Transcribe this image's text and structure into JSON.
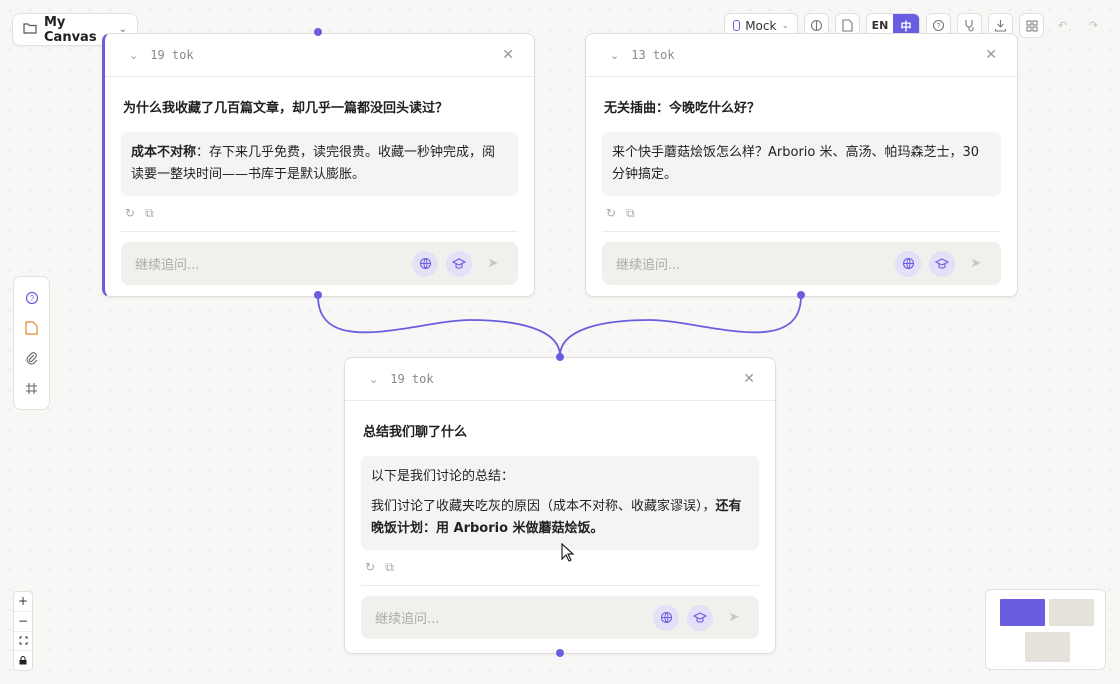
{
  "canvas_selector": {
    "label": "My Canvas",
    "icon": "folder-icon"
  },
  "toolbar": {
    "model_label": "Mock",
    "lang_en": "EN",
    "lang_zh": "中",
    "accent": "#6a5ee0"
  },
  "cards": [
    {
      "tokens": "19 tok",
      "question": "为什么我收藏了几百篇文章，却几乎一篇都没回头读过？",
      "answer_bold": "成本不对称",
      "answer_rest": "：存下来几乎免费，读完很贵。收藏一秒钟完成，阅读要一整块时间——书库于是默认膨胀。",
      "followup_placeholder": "继续追问..."
    },
    {
      "tokens": "13 tok",
      "question": "无关插曲：今晚吃什么好？",
      "answer": "来个快手蘑菇烩饭怎么样？Arborio 米、高汤、帕玛森芝士，30 分钟搞定。",
      "followup_placeholder": "继续追问..."
    },
    {
      "tokens": "19 tok",
      "question": "总结我们聊了什么",
      "answer_intro": "以下是我们讨论的总结：",
      "answer_main": "我们讨论了收藏夹吃灰的原因（成本不对称、收藏家谬误），",
      "answer_main_bold": "还有晚饭计划：用 Arborio 米做蘑菇烩饭。",
      "followup_placeholder": "继续追问..."
    }
  ],
  "zoom": {
    "in": "+",
    "out": "−"
  }
}
